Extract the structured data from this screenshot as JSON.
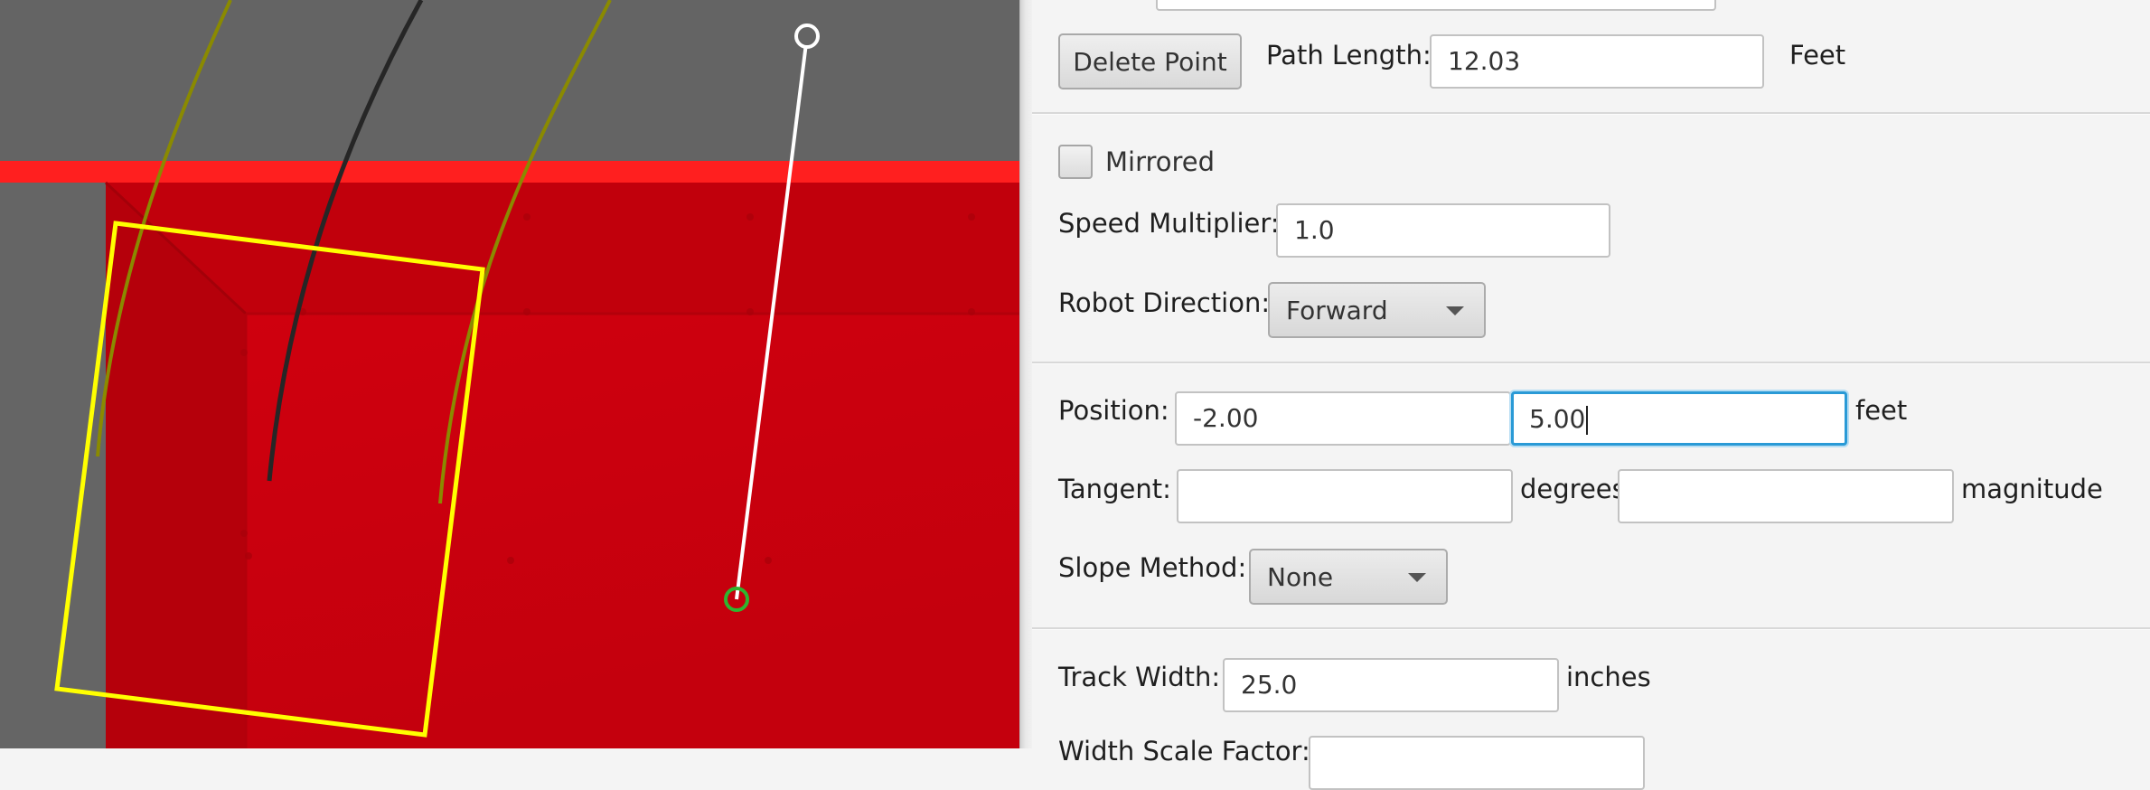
{
  "canvas": {
    "colors": {
      "background": "#646464",
      "field_red": "#d0000f",
      "field_line": "#ff1a1a",
      "robot_outline": "#ffff00",
      "center_path": "#222222",
      "side_paths": "#8a8a00",
      "tangent_line": "#ffffff",
      "selected_point": "#2fb52f",
      "control_handle": "#ffffff"
    }
  },
  "panel": {
    "delete_point_label": "Delete Point",
    "path_length_label": "Path Length:",
    "path_length_value": "12.03",
    "path_length_unit": "Feet",
    "mirrored_label": "Mirrored",
    "speed_multiplier_label": "Speed Multiplier:",
    "speed_multiplier_value": "1.0",
    "robot_direction_label": "Robot Direction:",
    "robot_direction_value": "Forward",
    "position_label": "Position:",
    "position_x": "-2.00",
    "position_y": "5.00",
    "position_unit": "feet",
    "tangent_label": "Tangent:",
    "tangent_degrees": "",
    "tangent_degrees_unit": "degrees",
    "tangent_magnitude": "",
    "tangent_magnitude_unit": "magnitude",
    "slope_method_label": "Slope Method:",
    "slope_method_value": "None",
    "track_width_label": "Track Width:",
    "track_width_value": "25.0",
    "track_width_unit": "inches",
    "width_scale_label": "Width Scale Factor:"
  }
}
